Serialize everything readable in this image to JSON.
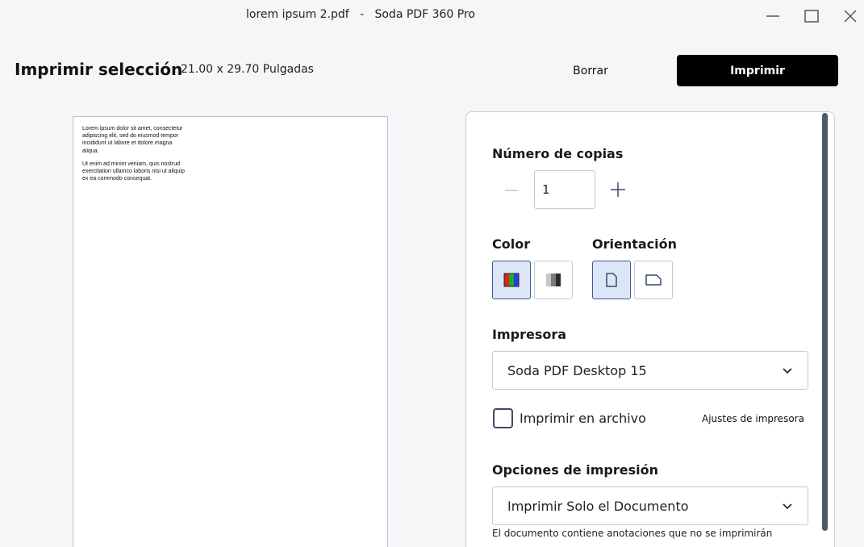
{
  "window": {
    "title": "lorem ipsum 2.pdf   -   Soda PDF 360 Pro"
  },
  "header": {
    "title": "Imprimir selección",
    "page_size": "21.00 x 29.70 Pulgadas",
    "clear_label": "Borrar",
    "print_label": "Imprimir"
  },
  "preview": {
    "paragraph1": "Lorem ipsum dolor sit amet, consectetur adipiscing elit, sed do eiusmod tempor incididunt ut labore et dolore magna aliqua.",
    "paragraph2": "Ut enim ad minim veniam, quis nostrud exercitation ullamco laboris nisi ut aliquip ex ea commodo consequat."
  },
  "settings": {
    "copies_label": "Número de copias",
    "copies_value": "1",
    "color_label": "Color",
    "color_selected": "color",
    "orientation_label": "Orientación",
    "orientation_selected": "portrait",
    "printer_label": "Impresora",
    "printer_value": "Soda PDF Desktop 15",
    "print_to_file_label": "Imprimir en archivo",
    "print_to_file_checked": false,
    "print_settings_link": "Ajustes de impresora",
    "print_options_label": "Opciones de impresión",
    "print_options_value": "Imprimir Solo el Documento",
    "annotations_note": "El documento contiene anotaciones que no se imprimirán"
  },
  "colors": {
    "selected_bg": "#dce6f7",
    "selected_border": "#3b5998",
    "primary_button": "#000000"
  }
}
